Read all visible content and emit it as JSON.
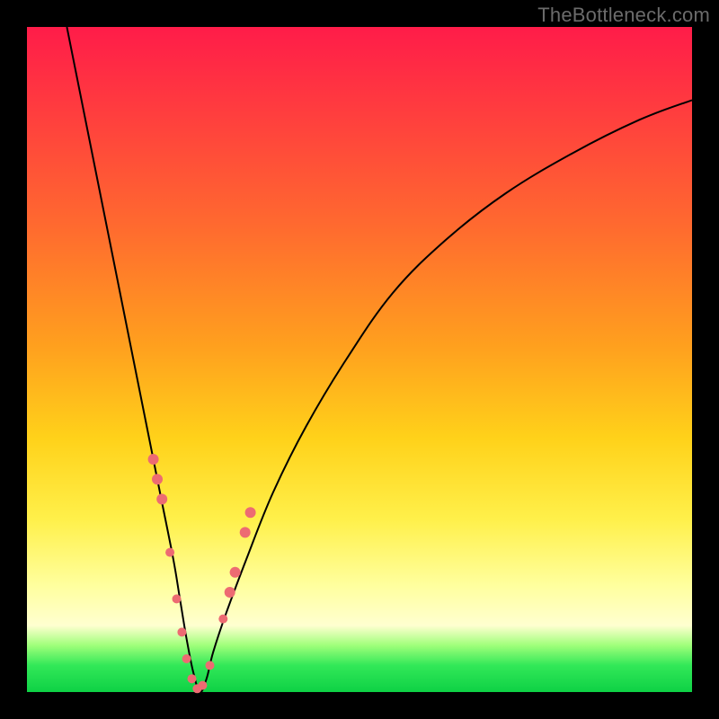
{
  "watermark": "TheBottleneck.com",
  "colors": {
    "marker": "#ed6b72",
    "curve": "#000000",
    "frame": "#000000"
  },
  "chart_data": {
    "type": "line",
    "title": "",
    "xlabel": "",
    "ylabel": "",
    "xlim": [
      0,
      100
    ],
    "ylim": [
      0,
      100
    ],
    "series": [
      {
        "name": "bottleneck-curve",
        "x": [
          6,
          8,
          10,
          12,
          14,
          16,
          18,
          20,
          22,
          23,
          24,
          25,
          26,
          27,
          28,
          30,
          33,
          37,
          42,
          48,
          55,
          63,
          72,
          82,
          92,
          100
        ],
        "y": [
          100,
          90,
          80,
          70,
          60,
          50,
          40,
          30,
          20,
          14,
          8,
          3,
          0,
          2,
          6,
          12,
          20,
          30,
          40,
          50,
          60,
          68,
          75,
          81,
          86,
          89
        ]
      }
    ],
    "markers": {
      "name": "highlighted-points",
      "x": [
        19.0,
        19.6,
        20.3,
        21.5,
        22.5,
        23.3,
        24.0,
        24.8,
        25.6,
        26.4,
        27.5,
        29.5,
        30.5,
        31.3,
        32.8,
        33.6
      ],
      "y": [
        35,
        32,
        29,
        21,
        14,
        9,
        5,
        2,
        0.5,
        1,
        4,
        11,
        15,
        18,
        24,
        27
      ],
      "r": [
        6,
        6,
        6,
        5,
        5,
        5,
        5,
        5,
        5,
        5,
        5,
        5,
        6,
        6,
        6,
        6
      ]
    }
  }
}
